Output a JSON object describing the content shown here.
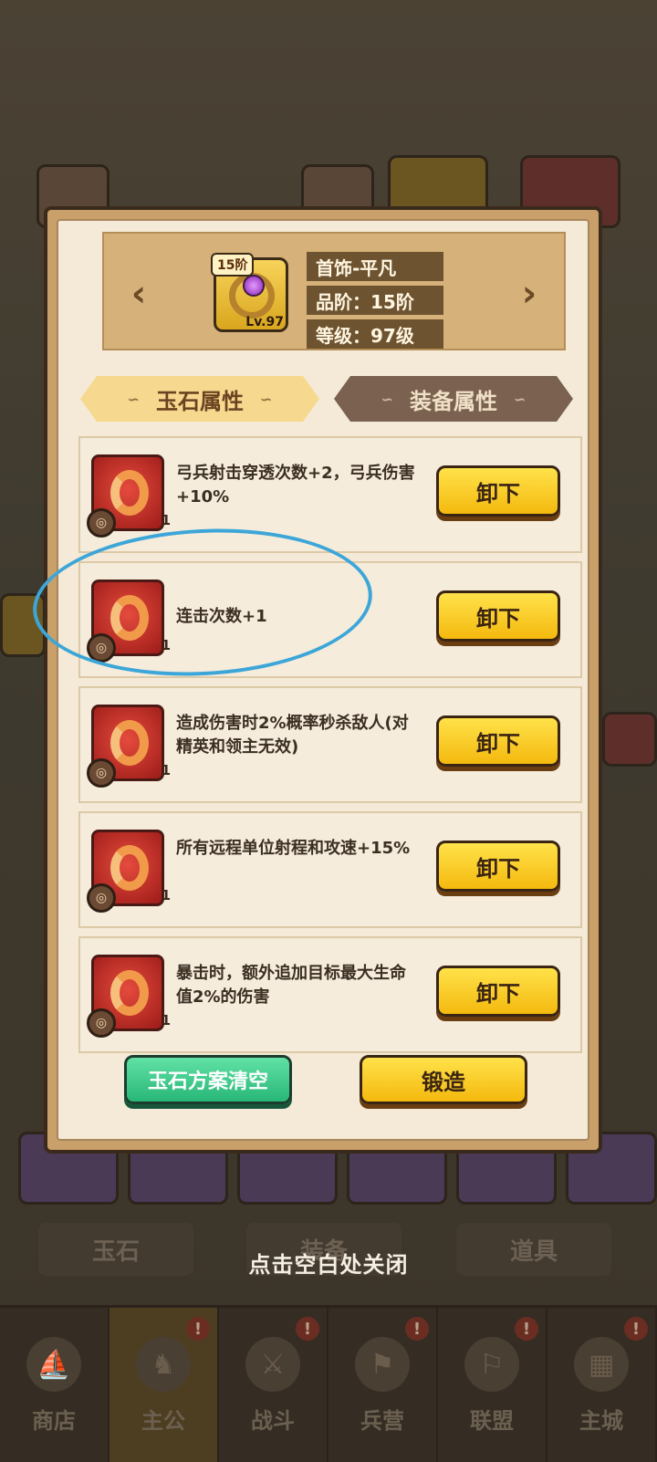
{
  "background": {
    "tabs": [
      "玉石",
      "装备",
      "道具"
    ],
    "nav": [
      {
        "label": "商店",
        "alert": false
      },
      {
        "label": "主公",
        "alert": true
      },
      {
        "label": "战斗",
        "alert": true
      },
      {
        "label": "兵营",
        "alert": true
      },
      {
        "label": "联盟",
        "alert": true
      },
      {
        "label": "主城",
        "alert": true
      }
    ],
    "alert_mark": "!",
    "close_hint": "点击空白处关闭"
  },
  "header": {
    "item_name": "首饰-平凡",
    "grade": "品阶：15阶",
    "level": "等级：97级",
    "tier_badge": "15阶",
    "lv_badge": "Lv.97",
    "prev_arrow": "‹",
    "next_arrow": "›"
  },
  "tabs": {
    "jade": "玉石属性",
    "equip": "装备属性",
    "deco": "∽"
  },
  "jade_slots": [
    {
      "text": "弓兵射击穿透次数+2，弓兵伤害+10%",
      "count": "1",
      "button": "卸下"
    },
    {
      "text": "连击次数+1",
      "count": "1",
      "button": "卸下"
    },
    {
      "text": "造成伤害时2%概率秒杀敌人(对精英和领主无效)",
      "count": "1",
      "button": "卸下"
    },
    {
      "text": "所有远程单位射程和攻速+15%",
      "count": "1",
      "button": "卸下"
    },
    {
      "text": "暴击时，额外追加目标最大生命值2%的伤害",
      "count": "1",
      "button": "卸下"
    }
  ],
  "actions": {
    "clear_plan": "玉石方案清空",
    "forge": "锻造"
  },
  "colors": {
    "annotation": "#3da6d8",
    "button_yellow": "#f4b90e",
    "button_green": "#28b777"
  }
}
